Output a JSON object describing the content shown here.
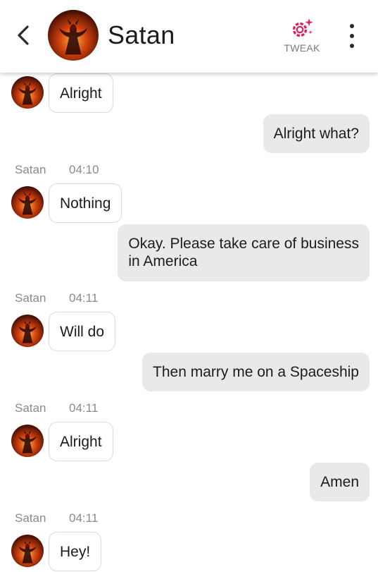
{
  "header": {
    "title": "Satan",
    "tweak_label": "TWEAK",
    "icons": {
      "back": "back-arrow-icon",
      "tweak": "gear-sparkle-icon",
      "menu": "more-vertical-icon"
    }
  },
  "colors": {
    "accent": "#e0205f",
    "incoming_bubble_border": "#dcdcdc",
    "outgoing_bubble_bg": "#e9e9e9",
    "meta_text": "#8a8a8a"
  },
  "messages": [
    {
      "direction": "in",
      "text": "Alright"
    },
    {
      "direction": "out",
      "text": "Alright what?"
    },
    {
      "direction": "meta",
      "sender": "Satan",
      "time": "04:10"
    },
    {
      "direction": "in",
      "text": "Nothing"
    },
    {
      "direction": "out",
      "lines": [
        "Okay. Please take care of business",
        "in America"
      ]
    },
    {
      "direction": "meta",
      "sender": "Satan",
      "time": "04:11"
    },
    {
      "direction": "in",
      "text": "Will do"
    },
    {
      "direction": "out",
      "text": "Then marry me on a Spaceship"
    },
    {
      "direction": "meta",
      "sender": "Satan",
      "time": "04:11"
    },
    {
      "direction": "in",
      "text": "Alright"
    },
    {
      "direction": "out",
      "text": "Amen"
    },
    {
      "direction": "meta",
      "sender": "Satan",
      "time": "04:11"
    },
    {
      "direction": "in",
      "text": "Hey!"
    }
  ]
}
